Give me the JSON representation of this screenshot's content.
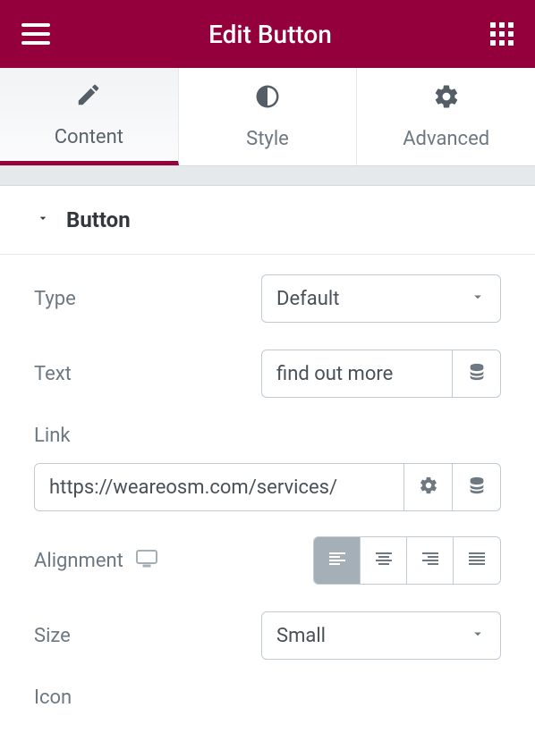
{
  "header": {
    "title": "Edit Button"
  },
  "tabs": {
    "content": "Content",
    "style": "Style",
    "advanced": "Advanced"
  },
  "section": {
    "title": "Button"
  },
  "fields": {
    "type": {
      "label": "Type",
      "value": "Default"
    },
    "text": {
      "label": "Text",
      "value": "find out more"
    },
    "link": {
      "label": "Link",
      "value": "https://weareosm.com/services/"
    },
    "alignment": {
      "label": "Alignment"
    },
    "size": {
      "label": "Size",
      "value": "Small"
    },
    "icon": {
      "label": "Icon"
    }
  }
}
